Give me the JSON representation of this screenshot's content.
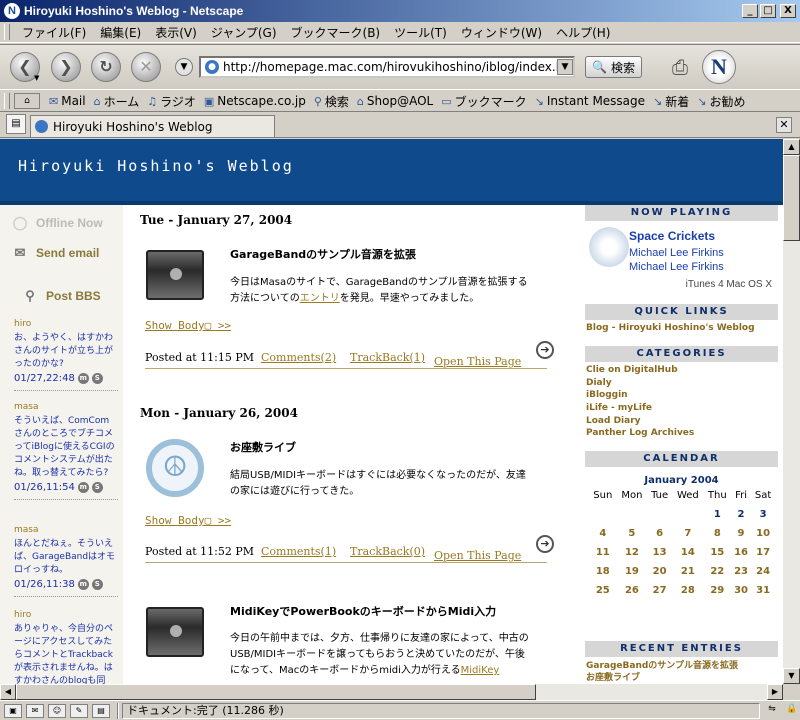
{
  "window": {
    "title": "Hiroyuki Hoshino's Weblog - Netscape",
    "btn_min": "_",
    "btn_max": "□",
    "btn_close": "X"
  },
  "menu": [
    "ファイル(F)",
    "編集(E)",
    "表示(V)",
    "ジャンプ(G)",
    "ブックマーク(B)",
    "ツール(T)",
    "ウィンドウ(W)",
    "ヘルプ(H)"
  ],
  "nav": {
    "url": "http://homepage.mac.com/hirovukihoshino/iblog/index.html",
    "search_label": "検索"
  },
  "personal_toolbar": [
    "Mail",
    "ホーム",
    "ラジオ",
    "Netscape.co.jp",
    "検索",
    "Shop@AOL",
    "ブックマーク",
    "Instant Message",
    "新着",
    "お勧め"
  ],
  "tab": {
    "label": "Hiroyuki Hoshino's Weblog"
  },
  "status": {
    "text": "ドキュメント:完了 (11.286 秒)"
  },
  "blog": {
    "title": "Hiroyuki Hoshino's Weblog",
    "left_nav": {
      "offline": "Offline Now",
      "send_email": "Send email",
      "post_bbs": "Post BBS"
    },
    "bbs": [
      {
        "who": "hiro",
        "msg": "お、ようやく、はすかわさんのサイトが立ち上がったのかな?",
        "meta": "01/27,22:48"
      },
      {
        "who": "masa",
        "msg": "そういえば、ComComさんのところでブチコメってiBlogに使えるCGIのコメントシステムが出たね。取っ替えてみたら?",
        "meta": "01/26,11:54"
      },
      {
        "who": "masa",
        "msg": "ほんとだねぇ。そういえば、GarageBandはオモロイっすね。",
        "meta": "01/26,11:38"
      },
      {
        "who": "hiro",
        "msg": "ありゃりゃ、今自分のページにアクセスしてみたらコメントとTrackbackが表示されませんね。はすかわさんのblogも同",
        "meta": ""
      }
    ],
    "entries": [
      {
        "date": "Tue - January 27, 2004",
        "title": "GarageBandのサンプル音源を拡張",
        "body_before": "今日はMasaのサイトで、GarageBandのサンプル音源を拡張する方法についての",
        "body_link": "エントリ",
        "body_after": "を発見。早速やってみました。",
        "show_body": "Show Body▢ >>",
        "posted": "Posted at 11:15 PM",
        "comments": "Comments(2)",
        "trackback": "TrackBack(1)",
        "open": "Open This Page"
      },
      {
        "date": "Mon - January 26, 2004",
        "title": "お座敷ライブ",
        "body_before": "結局USB/MIDIキーボードはすぐには必要なくなったのだが、友達の家には遊びに行ってきた。",
        "show_body": "Show Body▢ >>",
        "posted": "Posted at 11:52 PM",
        "comments": "Comments(1)",
        "trackback": "TrackBack(0)",
        "open": "Open This Page"
      },
      {
        "title": "MidiKeyでPowerBookのキーボードからMidi入力",
        "body_before": "今日の午前中までは、夕方、仕事帰りに友達の家によって、中古のUSB/MIDIキーボードを譲ってもらおうと決めていたのだが、午後になって、Macのキーボードからmidi入力が行える",
        "body_link": "MidiKey"
      }
    ],
    "right": {
      "now_playing_head": "NOW PLAYING",
      "song": "Space Crickets",
      "artist1": "Michael Lee Firkins",
      "artist2": "Michael Lee Firkins",
      "itunes": "iTunes 4 Mac OS X",
      "quick_links_head": "QUICK LINKS",
      "quick_link": "Blog - Hiroyuki Hoshino's Weblog",
      "categories_head": "CATEGORIES",
      "categories": [
        "Clie on DigitalHub",
        "Dialy",
        "iBloggin",
        "iLife - myLife",
        "Load Diary",
        "Panther Log Archives"
      ],
      "calendar_head": "CALENDAR",
      "calendar_month": "January 2004",
      "weekdays": [
        "Sun",
        "Mon",
        "Tue",
        "Wed",
        "Thu",
        "Fri",
        "Sat"
      ],
      "weeks": [
        [
          "",
          "",
          "",
          "",
          "1",
          "2",
          "3"
        ],
        [
          "4",
          "5",
          "6",
          "7",
          "8",
          "9",
          "10"
        ],
        [
          "11",
          "12",
          "13",
          "14",
          "15",
          "16",
          "17"
        ],
        [
          "18",
          "19",
          "20",
          "21",
          "22",
          "23",
          "24"
        ],
        [
          "25",
          "26",
          "27",
          "28",
          "29",
          "30",
          "31"
        ]
      ],
      "recent_head": "RECENT ENTRIES",
      "recent": [
        "GarageBandのサンプル音源を拡張",
        "お座敷ライブ"
      ]
    }
  }
}
